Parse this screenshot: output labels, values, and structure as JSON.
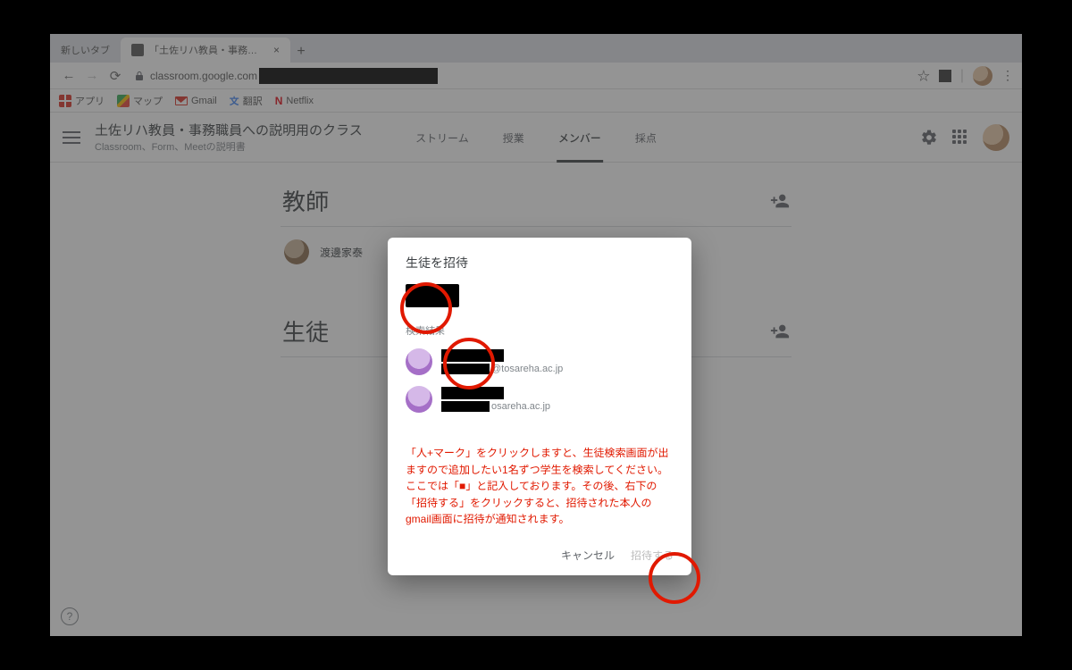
{
  "browser": {
    "tabs": [
      {
        "title": "新しいタブ",
        "active": false
      },
      {
        "title": "「土佐リハ教員・事務職員への説明",
        "active": true
      }
    ],
    "url_visible": "classroom.google.com",
    "bookmarks": {
      "apps": "アプリ",
      "maps": "マップ",
      "gmail": "Gmail",
      "translate": "翻訳",
      "netflix": "Netflix"
    }
  },
  "classroom": {
    "title": "土佐リハ教員・事務職員への説明用のクラス",
    "subtitle": "Classroom、Form、Meetの説明書",
    "tabs": {
      "stream": "ストリーム",
      "work": "授業",
      "people": "メンバー",
      "grades": "採点"
    },
    "sections": {
      "teachers_heading": "教師",
      "students_heading": "生徒",
      "teacher_name": "渡邊家泰"
    }
  },
  "modal": {
    "title": "生徒を招待",
    "results_label": "検索結果",
    "results": [
      {
        "email_visible_suffix": "@tosareha.ac.jp"
      },
      {
        "email_visible_suffix": "osareha.ac.jp"
      }
    ],
    "annotation": "「人+マーク」をクリックしますと、生徒検索画面が出ますので追加したい1名ずつ学生を検索してください。ここでは「■」と記入しております。その後、右下の「招待する」をクリックすると、招待された本人のgmail画面に招待が通知されます。",
    "cancel": "キャンセル",
    "invite": "招待する"
  }
}
